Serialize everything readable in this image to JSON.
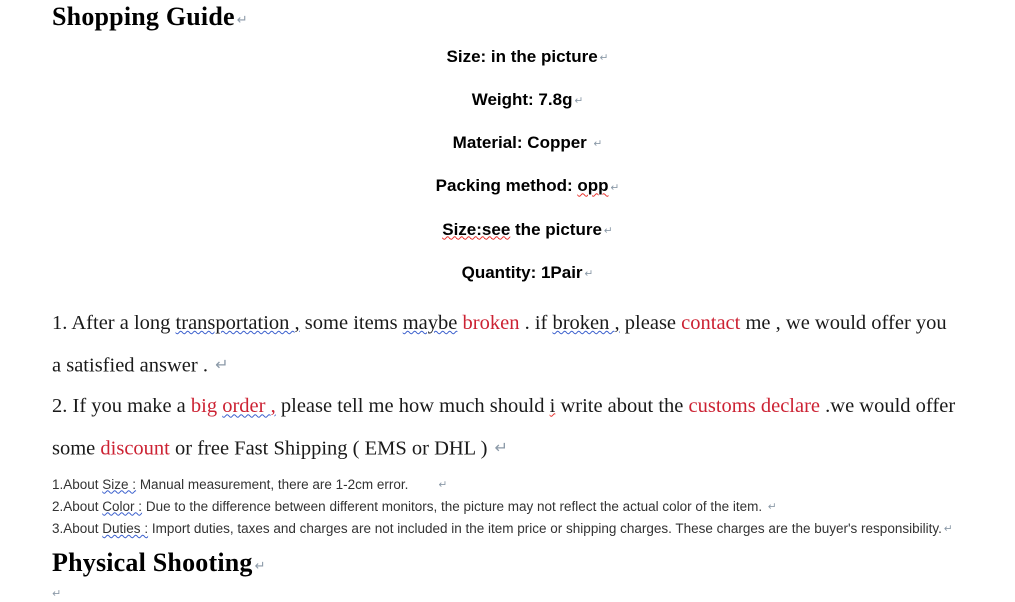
{
  "document": {
    "heading_1": "Shopping Guide",
    "heading_2": "Physical Shooting",
    "return_mark": "↵"
  },
  "specs": {
    "lines": [
      {
        "text": "Size: in the picture",
        "misspelled": false
      },
      {
        "text": "Weight: 7.8g",
        "misspelled": false
      },
      {
        "text": "Material: Copper ",
        "misspelled": false
      },
      {
        "prefix": "Packing method: ",
        "flagged": "opp",
        "flag_color": "red",
        "suffix": ""
      },
      {
        "prefix": "",
        "flagged": "Size:see",
        "flag_color": "red",
        "suffix": " the picture"
      },
      {
        "text": "Quantity: 1Pair",
        "misspelled": false
      }
    ],
    "line_1": "Size: in the picture",
    "line_2": "Weight: 7.8g",
    "line_3": "Material: Copper ",
    "line_4_prefix": "Packing method: ",
    "line_4_flagged": "opp",
    "line_5_flagged": "Size:see",
    "line_5_suffix": " the picture",
    "line_6": "Quantity: 1Pair"
  },
  "terms": {
    "para_1": {
      "number": "1. ",
      "t1": "After a long ",
      "t2_grammar": "transportation ,",
      "t3": " some items ",
      "t4_grammar": "maybe",
      "t5": " ",
      "t6_red": "broken",
      "t7": " . if ",
      "t8_grammar": "broken ,",
      "t9": " please ",
      "t10_red": "contact",
      "t11": " me , we would offer you",
      "t12": "a satisfied answer . "
    },
    "para_2": {
      "number": "2. ",
      "t1": "If you make a ",
      "t2_red": "big ",
      "t3_red_grammar": "order ,",
      "t4": " please tell me how much should ",
      "t5_flagged": "i",
      "t6": " write about the ",
      "t7_red": "customs declare",
      "t8": " .we would offer",
      "t9": "some ",
      "t10_red": "discount",
      "t11": " or free Fast Shipping ( EMS or DHL ) "
    }
  },
  "notes": {
    "note_1_prefix": "1.About ",
    "note_1_flagged": "Size :",
    "note_1_suffix": " Manual measurement, there are 1-2cm error.",
    "note_2_prefix": "2.About ",
    "note_2_flagged": "Color :",
    "note_2_suffix": " Due to the difference between different monitors, the picture may not reflect the actual color of the item. ",
    "note_3_prefix": "3.About ",
    "note_3_flagged": "Duties :",
    "note_3_suffix": " Import duties, taxes and charges are not included in the item price or shipping charges. These charges are the buyer's responsibility."
  },
  "colors": {
    "highlight_red": "#CC2233",
    "spellcheck_red": "#E8322D",
    "grammar_blue": "#3A5FCD",
    "return_mark": "#8C9AA8",
    "body_text": "#1A1A1A"
  }
}
